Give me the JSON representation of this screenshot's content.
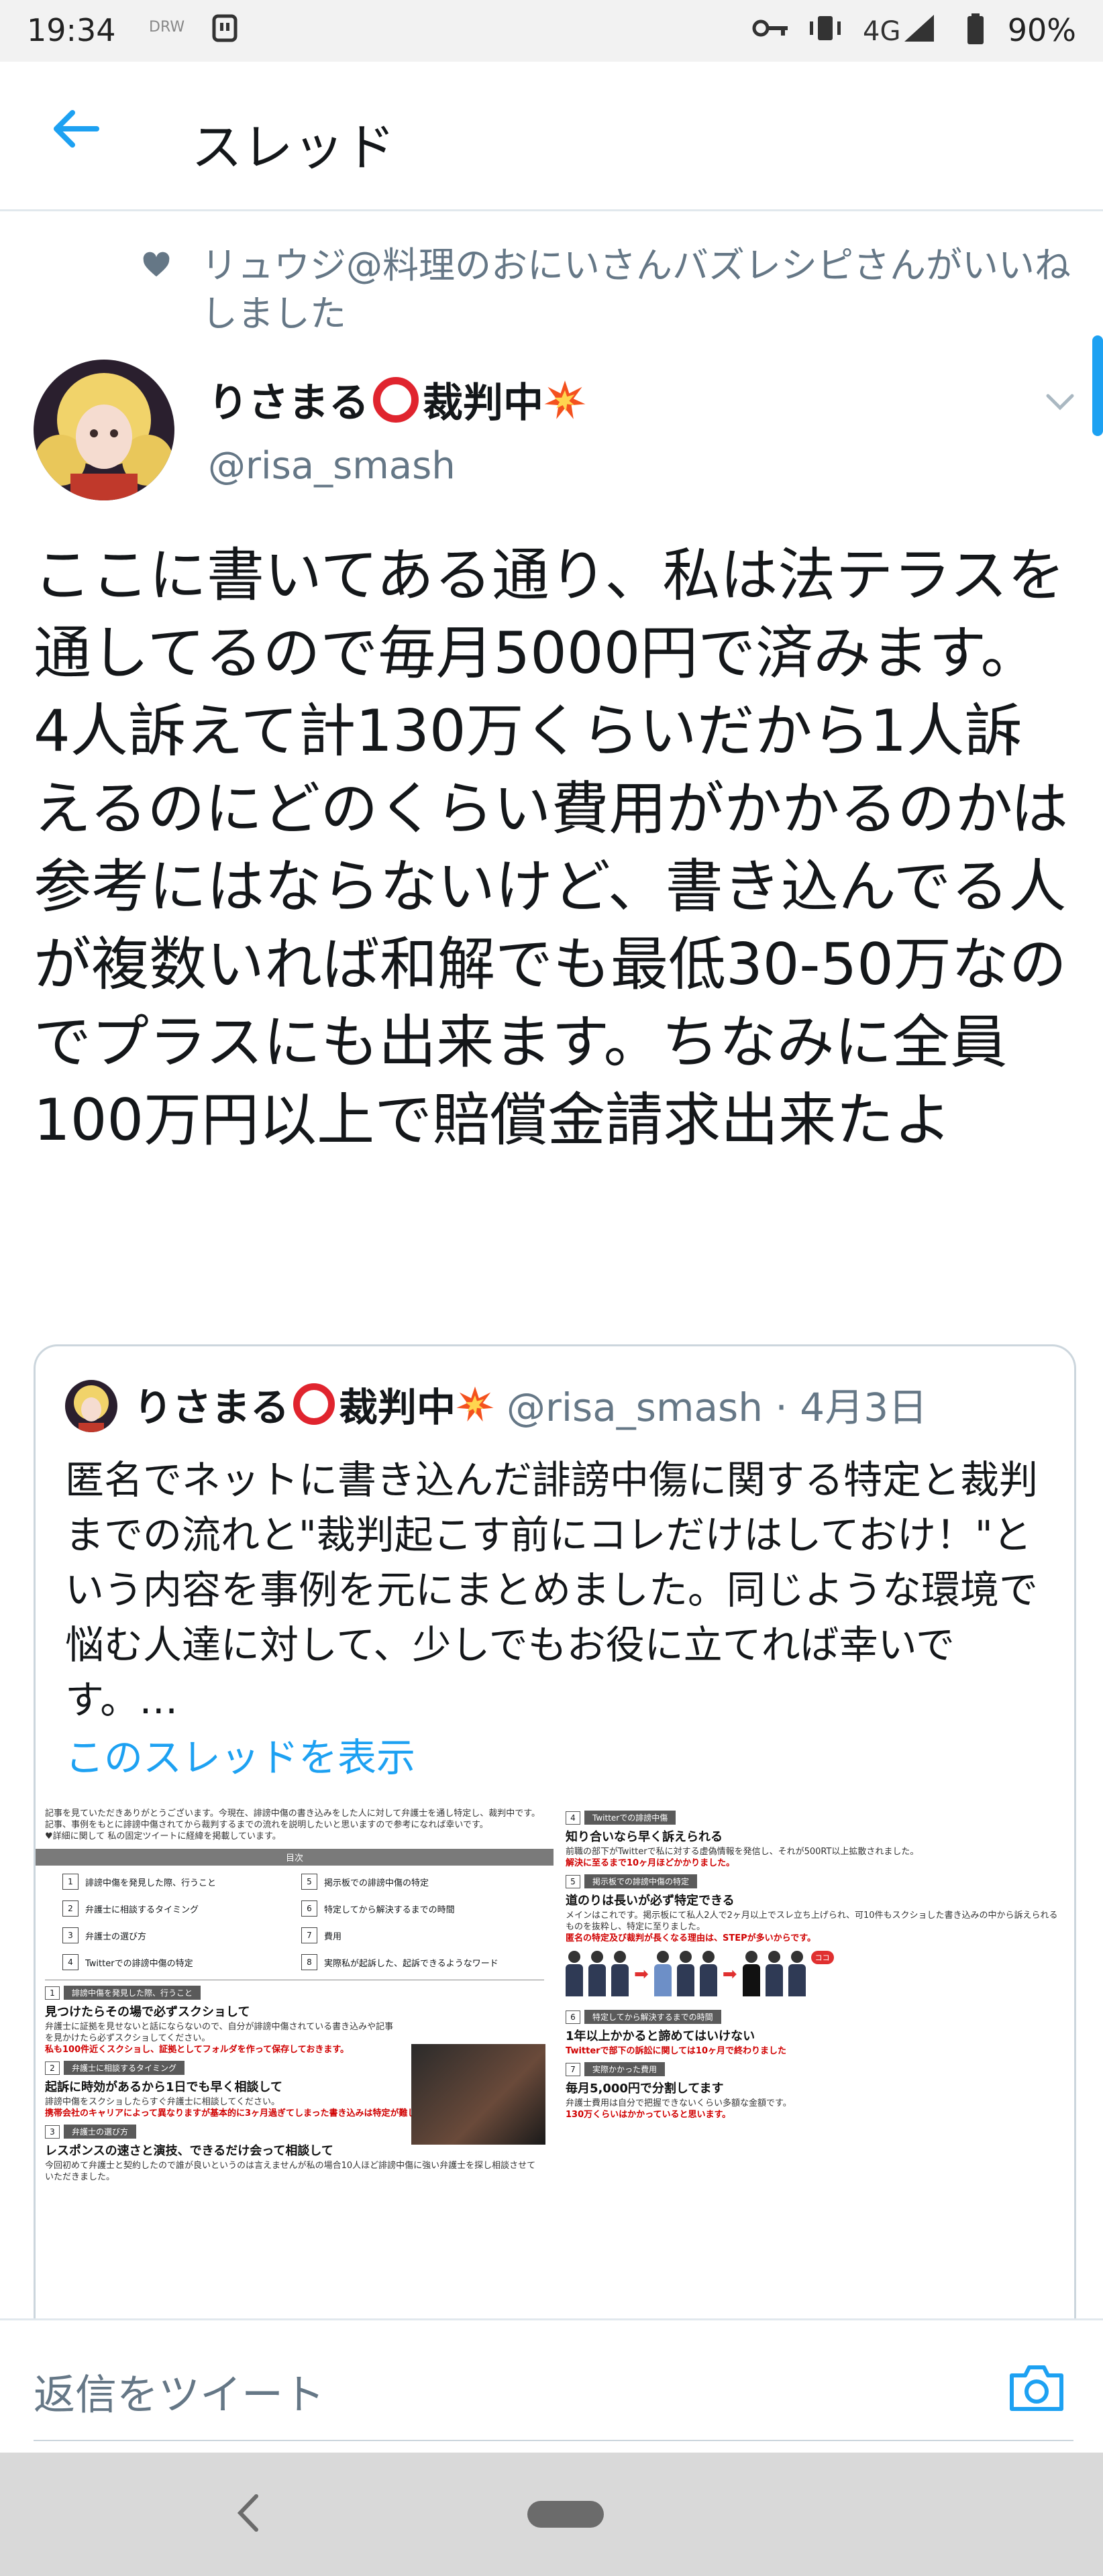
{
  "status_bar": {
    "time": "19:34",
    "small_label": "DRW",
    "network": "4G",
    "battery": "90%"
  },
  "header": {
    "title": "スレッド"
  },
  "liked": {
    "text": "リュウジ@料理のおにいさんバズレシピさんがいいねしました"
  },
  "tweet": {
    "author_name": "りさまる",
    "author_suffix": "裁判中",
    "handle": "@risa_smash",
    "body": "ここに書いてある通り、私は法テラスを通してるので毎月5000円で済みます。\n4人訴えて計130万くらいだから1人訴えるのにどのくらい費用がかかるのかは参考にはならないけど、書き込んでる人が複数いれば和解でも最低30-50万なのでプラスにも出来ます。ちなみに全員100万円以上で賠償金請求出来たよ"
  },
  "quote": {
    "author_name": "りさまる",
    "author_suffix": "裁判中",
    "handle_date": "@risa_smash · 4月3日",
    "body": "匿名でネットに書き込んだ誹謗中傷に関する特定と裁判までの流れと\"裁判起こす前にコレだけはしておけ！\"という内容を事例を元にまとめました。同じような環境で悩む人達に対して、少しでもお役に立てれば幸いです。…",
    "show_thread": "このスレッドを表示"
  },
  "doc_left": {
    "intro": "記事を見ていただきありがとうございます。今現在、誹謗中傷の書き込みをした人に対して弁護士を通し特定し、裁判中です。記事、事例をもとに誹謗中傷されてから裁判するまでの流れを説明したいと思いますので参考になれば幸いです。",
    "intro2": "♥詳細に関して 私の固定ツイートに経緯を掲載しています。",
    "toc_title": "目次",
    "toc": [
      {
        "n": "1",
        "t": "誹謗中傷を発見した際、行うこと"
      },
      {
        "n": "5",
        "t": "掲示板での誹謗中傷の特定"
      },
      {
        "n": "2",
        "t": "弁護士に相談するタイミング"
      },
      {
        "n": "6",
        "t": "特定してから解決するまでの時間"
      },
      {
        "n": "3",
        "t": "弁護士の選び方"
      },
      {
        "n": "7",
        "t": "費用"
      },
      {
        "n": "4",
        "t": "Twitterでの誹謗中傷の特定"
      },
      {
        "n": "8",
        "t": "実際私が起訴した、起訴できるようなワード"
      }
    ],
    "s1_bar": "誹謗中傷を発見した際、行うこと",
    "s1_head": "見つけたらその場で必ずスクショして",
    "s1_text": "弁護士に証拠を見せないと話にならないので、自分が誹謗中傷されている書き込みや記事を見かけたら必ずスクショしてください。",
    "s1_red": "私も100件近くスクショし、証拠としてフォルダを作って保存しておきます。",
    "s2_bar": "弁護士に相談するタイミング",
    "s2_head": "起訴に時効があるから1日でも早く相談して",
    "s2_text": "誹謗中傷をスクショしたらすぐ弁護士に相談してください。",
    "s2_red": "携帯会社のキャリアによって異なりますが基本的に3ヶ月過ぎてしまった書き込みは特定が難しいです。",
    "s3_bar": "弁護士の選び方",
    "s3_head": "レスポンスの速さと演技、できるだけ会って相談して",
    "s3_text": "今回初めて弁護士と契約したので誰が良いというのは言えませんが私の場合10人ほど誹謗中傷に強い弁護士を探し相談させていただきました。"
  },
  "doc_right": {
    "s4_bar": "Twitterでの誹謗中傷",
    "s4_head": "知り合いなら早く訴えられる",
    "s4_text": "前職の部下がTwitterで私に対する虚偽情報を発信し、それが500RT以上拡散されました。",
    "s4_red": "解決に至るまで10ヶ月ほどかかりました。",
    "s5_bar": "掲示板での誹謗中傷の特定",
    "s5_head": "道のりは長いが必ず特定できる",
    "s5_text": "メインはこれです。掲示板にて私人2人で2ヶ月以上でスレ立ち上げられ、可10件もスクショした書き込みの中から訴えられるものを抜粋し、特定に至りました。",
    "s5_red": "匿名の特定及び裁判が長くなる理由は、STEPが多いからです。",
    "s6_bar": "特定してから解決するまでの時間",
    "s6_head": "1年以上かかると諦めてはいけない",
    "s6_red": "Twitterで部下の訴訟に関しては10ヶ月で終わりました",
    "s7_bar": "実際かかった費用",
    "s7_head": "毎月5,000円で分割してます",
    "s7_text": "弁護士費用は自分で把握できないくらい多額な金額です。",
    "s7_red": "130万くらいはかかっていると思います。",
    "badge": "ココ"
  },
  "reply": {
    "placeholder": "返信をツイート"
  },
  "colors": {
    "accent": "#1da1f2",
    "secondary_text": "#657786",
    "border": "#e1e8ed",
    "red_mark": "#e0242e"
  }
}
